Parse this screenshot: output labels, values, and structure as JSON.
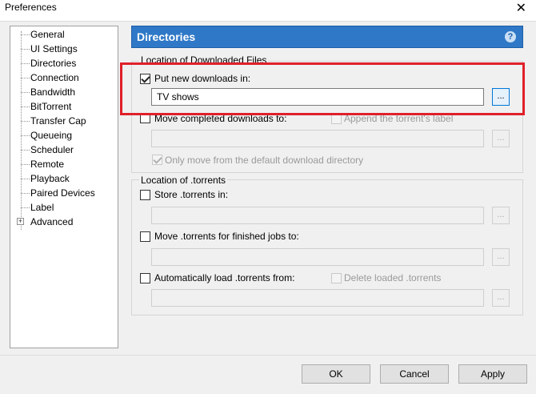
{
  "window": {
    "title": "Preferences",
    "close_glyph": "✕"
  },
  "tree": {
    "items": [
      {
        "label": "General",
        "expander": false
      },
      {
        "label": "UI Settings",
        "expander": false
      },
      {
        "label": "Directories",
        "expander": false
      },
      {
        "label": "Connection",
        "expander": false
      },
      {
        "label": "Bandwidth",
        "expander": false
      },
      {
        "label": "BitTorrent",
        "expander": false
      },
      {
        "label": "Transfer Cap",
        "expander": false
      },
      {
        "label": "Queueing",
        "expander": false
      },
      {
        "label": "Scheduler",
        "expander": false
      },
      {
        "label": "Remote",
        "expander": false
      },
      {
        "label": "Playback",
        "expander": false
      },
      {
        "label": "Paired Devices",
        "expander": false
      },
      {
        "label": "Label",
        "expander": false
      },
      {
        "label": "Advanced",
        "expander": true
      }
    ],
    "expander_glyph": "+"
  },
  "header": {
    "title": "Directories",
    "help_glyph": "?"
  },
  "downloaded_group": {
    "legend": "Location of Downloaded Files",
    "put_new": {
      "label": "Put new downloads in:",
      "checked": true
    },
    "put_new_path": "TV shows",
    "move_completed": {
      "label": "Move completed downloads to:",
      "checked": false
    },
    "append_label": {
      "label": "Append the torrent's label",
      "checked": false
    },
    "only_move": {
      "label": "Only move from the default download directory",
      "checked": true
    }
  },
  "torrents_group": {
    "legend": "Location of .torrents",
    "store": {
      "label": "Store .torrents in:",
      "checked": false
    },
    "move_finished": {
      "label": "Move .torrents for finished jobs to:",
      "checked": false
    },
    "auto_load": {
      "label": "Automatically load .torrents from:",
      "checked": false
    },
    "delete_loaded": {
      "label": "Delete loaded .torrents",
      "checked": false
    }
  },
  "browse_label": "...",
  "buttons": {
    "ok": "OK",
    "cancel": "Cancel",
    "apply": "Apply"
  },
  "colors": {
    "header_bg": "#2f78c7",
    "highlight": "#e0202a"
  }
}
